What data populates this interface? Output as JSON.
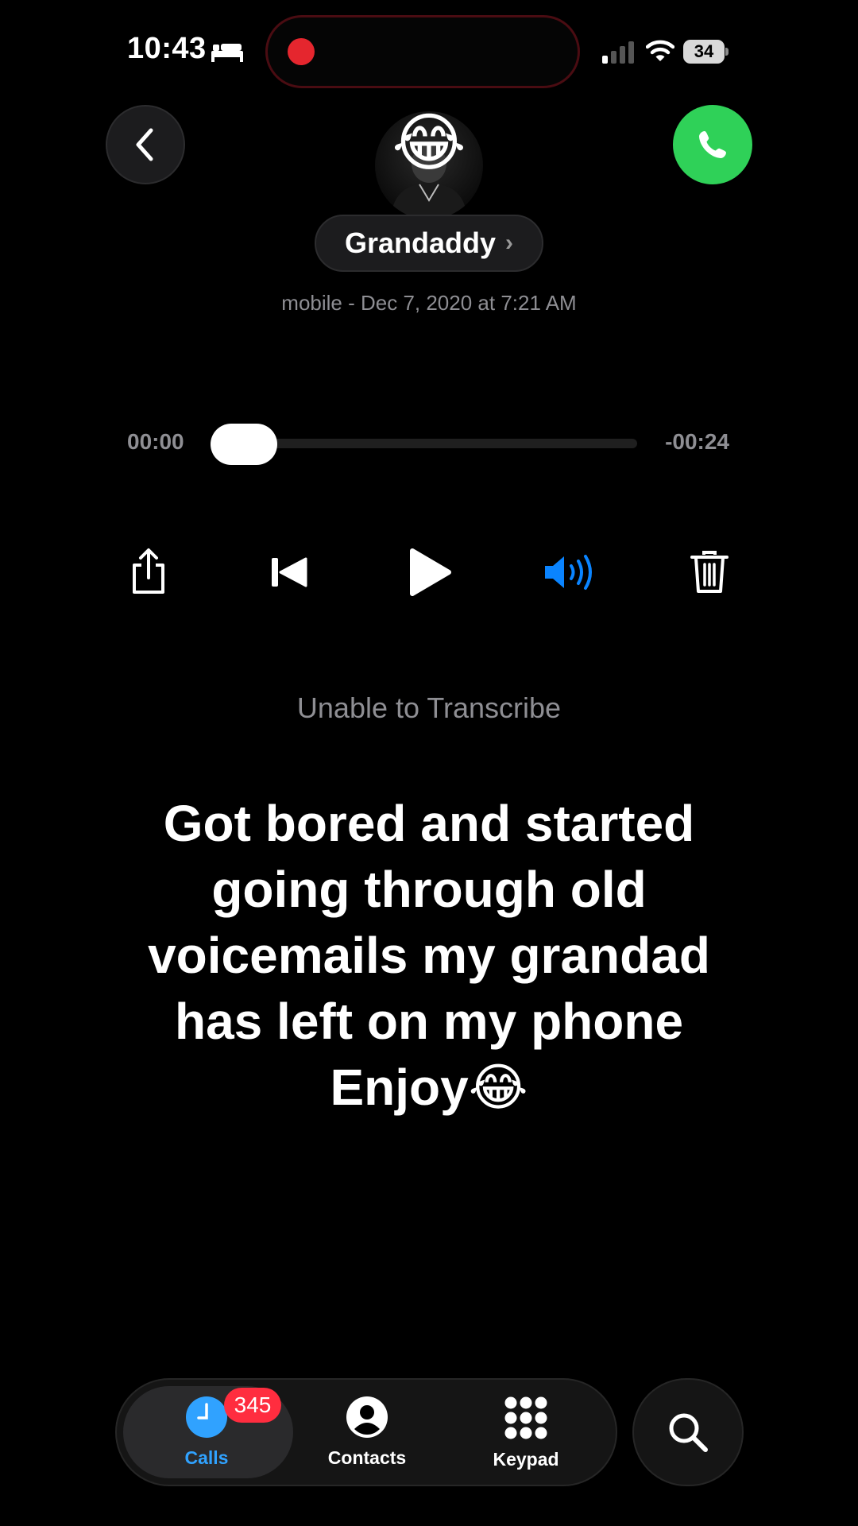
{
  "status_bar": {
    "time": "10:43",
    "battery": "34",
    "icons": [
      "bed-icon",
      "recording-dot-icon",
      "cellular-signal-icon",
      "wifi-icon",
      "battery-icon"
    ]
  },
  "header": {
    "contact_name": "Grandaddy",
    "name_chevron": "›",
    "avatar_emoji": "😂",
    "subtitle": "mobile - Dec 7, 2020 at 7:21 AM"
  },
  "player": {
    "elapsed": "00:00",
    "remaining": "-00:24",
    "progress": 0,
    "controls": [
      "share-icon",
      "rewind-icon",
      "play-icon",
      "speaker-icon",
      "trash-icon"
    ],
    "speaker_active_color": "#0a84ff"
  },
  "transcription": {
    "status": "Unable to Transcribe"
  },
  "caption": {
    "lines": [
      "Got bored and started",
      "going through old",
      "voicemails my grandad",
      "has left on my phone",
      "Enjoy😂"
    ]
  },
  "tabbar": {
    "tabs": [
      {
        "label": "Calls",
        "icon": "clock-icon",
        "selected": true
      },
      {
        "label": "Contacts",
        "icon": "person-circle-icon",
        "selected": false
      },
      {
        "label": "Keypad",
        "icon": "keypad-icon",
        "selected": false
      }
    ],
    "calls_badge": "345",
    "accent": "#30a2ff",
    "search_icon": "search-icon"
  }
}
